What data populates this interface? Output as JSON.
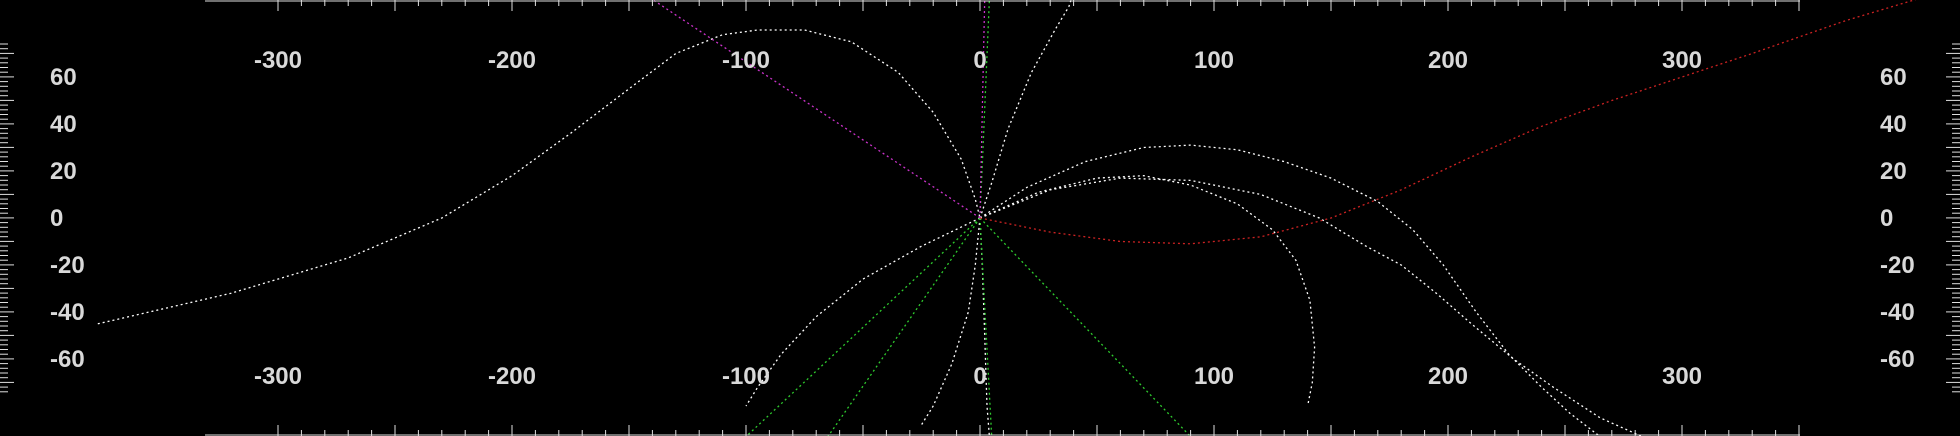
{
  "chart_data": {
    "type": "line",
    "title": "",
    "xlabel": "",
    "ylabel": "",
    "xlim": [
      -380,
      418
    ],
    "ylim": [
      -93,
      93
    ],
    "grid": false,
    "background": "#000000",
    "axis_color": "#e0e0e0",
    "label_color": "#d9d9d9",
    "x_ticks": [
      -300,
      -200,
      -100,
      0,
      100,
      200,
      300
    ],
    "x_tick_labels": [
      "-300",
      "-200",
      "-100",
      "0",
      "100",
      "200",
      "300"
    ],
    "y_ticks": [
      60,
      40,
      20,
      0,
      -20,
      -40,
      -60
    ],
    "y_tick_labels": [
      "60",
      "40",
      "20",
      "0",
      "-20",
      "-40",
      "-60"
    ],
    "series": [
      {
        "color": "#ffffff",
        "points": [
          [
            -377,
            -45
          ],
          [
            -320,
            -32
          ],
          [
            -270,
            -17
          ],
          [
            -230,
            0
          ],
          [
            -200,
            18
          ],
          [
            -175,
            36
          ],
          [
            -150,
            55
          ],
          [
            -130,
            70
          ],
          [
            -110,
            78
          ],
          [
            -95,
            80
          ],
          [
            -75,
            80
          ],
          [
            -55,
            75
          ],
          [
            -35,
            62
          ],
          [
            -20,
            45
          ],
          [
            -8,
            25
          ],
          [
            -2,
            8
          ],
          [
            0,
            0
          ]
        ]
      },
      {
        "color": "#ffffff",
        "points": [
          [
            0,
            0
          ],
          [
            5,
            15
          ],
          [
            12,
            38
          ],
          [
            22,
            62
          ],
          [
            32,
            80
          ],
          [
            38,
            90
          ],
          [
            40,
            96
          ]
        ]
      },
      {
        "color": "#ffffff",
        "points": [
          [
            0,
            0
          ],
          [
            20,
            13
          ],
          [
            45,
            24
          ],
          [
            70,
            30
          ],
          [
            90,
            31
          ],
          [
            110,
            29
          ],
          [
            130,
            24
          ],
          [
            150,
            17
          ],
          [
            170,
            7
          ],
          [
            185,
            -5
          ],
          [
            198,
            -20
          ],
          [
            212,
            -40
          ],
          [
            226,
            -58
          ],
          [
            240,
            -72
          ],
          [
            252,
            -83
          ],
          [
            265,
            -93
          ]
        ]
      },
      {
        "color": "#ffffff",
        "points": [
          [
            0,
            0
          ],
          [
            30,
            12
          ],
          [
            60,
            17
          ],
          [
            90,
            16
          ],
          [
            120,
            10
          ],
          [
            145,
            0
          ],
          [
            165,
            -12
          ],
          [
            180,
            -20
          ],
          [
            195,
            -32
          ],
          [
            210,
            -45
          ],
          [
            228,
            -60
          ],
          [
            245,
            -72
          ],
          [
            265,
            -85
          ],
          [
            283,
            -93
          ]
        ]
      },
      {
        "color": "#ffffff",
        "points": [
          [
            0,
            0
          ],
          [
            25,
            11
          ],
          [
            50,
            17
          ],
          [
            70,
            18
          ],
          [
            90,
            14
          ],
          [
            110,
            6
          ],
          [
            125,
            -5
          ],
          [
            135,
            -18
          ],
          [
            141,
            -35
          ],
          [
            143,
            -55
          ],
          [
            142,
            -70
          ],
          [
            140,
            -80
          ]
        ]
      },
      {
        "color": "#ffffff",
        "points": [
          [
            0,
            0
          ],
          [
            -25,
            -12
          ],
          [
            -50,
            -26
          ],
          [
            -70,
            -42
          ],
          [
            -85,
            -58
          ],
          [
            -95,
            -72
          ],
          [
            -100,
            -80
          ]
        ]
      },
      {
        "color": "#ffffff",
        "points": [
          [
            0,
            0
          ],
          [
            -2,
            -20
          ],
          [
            -5,
            -40
          ],
          [
            -12,
            -62
          ],
          [
            -20,
            -80
          ],
          [
            -25,
            -88
          ]
        ]
      },
      {
        "color": "#ffffff",
        "points": [
          [
            0,
            0
          ],
          [
            1,
            -20
          ],
          [
            2,
            -50
          ],
          [
            3,
            -80
          ],
          [
            4,
            -93
          ]
        ]
      },
      {
        "color": "#2ecc2e",
        "points": [
          [
            0,
            0
          ],
          [
            -100,
            -93
          ]
        ]
      },
      {
        "color": "#2ecc2e",
        "points": [
          [
            0,
            0
          ],
          [
            -65,
            -93
          ]
        ]
      },
      {
        "color": "#2ecc2e",
        "points": [
          [
            0,
            0
          ],
          [
            5,
            -93
          ]
        ]
      },
      {
        "color": "#2ecc2e",
        "points": [
          [
            0,
            0
          ],
          [
            90,
            -93
          ]
        ]
      },
      {
        "color": "#2ecc2e",
        "points": [
          [
            0,
            0
          ],
          [
            4,
            93
          ]
        ]
      },
      {
        "color": "#cc33cc",
        "points": [
          [
            0,
            0
          ],
          [
            -140,
            93
          ]
        ]
      },
      {
        "color": "#cc33cc",
        "points": [
          [
            0,
            0
          ],
          [
            2,
            93
          ]
        ]
      },
      {
        "color": "#cc2222",
        "points": [
          [
            0,
            0
          ],
          [
            30,
            -6
          ],
          [
            60,
            -10
          ],
          [
            90,
            -11
          ],
          [
            120,
            -8
          ],
          [
            150,
            0
          ],
          [
            180,
            12
          ],
          [
            210,
            26
          ],
          [
            240,
            39
          ],
          [
            270,
            50
          ],
          [
            300,
            60
          ],
          [
            330,
            70
          ],
          [
            350,
            77
          ],
          [
            370,
            84
          ],
          [
            390,
            90
          ],
          [
            400,
            93
          ]
        ]
      }
    ]
  }
}
